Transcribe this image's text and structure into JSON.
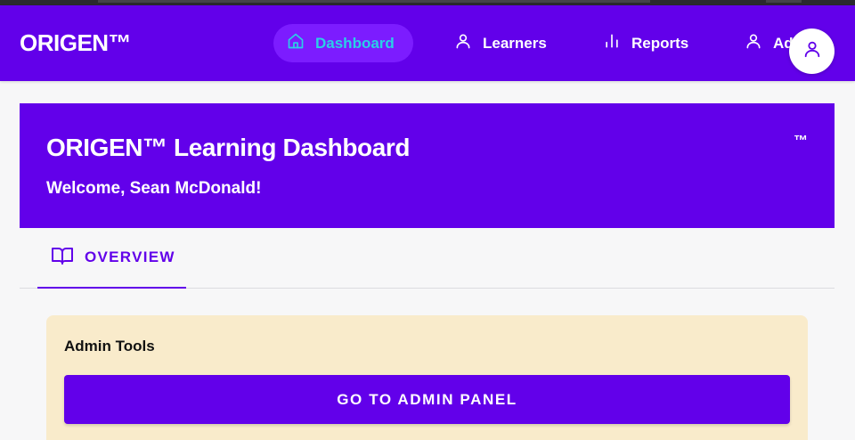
{
  "navbar": {
    "brand": "ORIGEN™",
    "items": [
      {
        "label": "Dashboard",
        "icon": "home-icon",
        "active": true
      },
      {
        "label": "Learners",
        "icon": "person-icon"
      },
      {
        "label": "Reports",
        "icon": "bar-chart-icon"
      },
      {
        "label": "Admin",
        "icon": "person-icon"
      }
    ],
    "avatar_icon": "user-icon"
  },
  "hero": {
    "title": "ORIGEN™ Learning Dashboard",
    "subtitle": "Welcome, Sean McDonald!",
    "tm": "™"
  },
  "tabs": [
    {
      "label": "OVERVIEW",
      "icon": "book-open-icon",
      "active": true
    }
  ],
  "admin_tools": {
    "title": "Admin Tools",
    "button_label": "GO TO ADMIN PANEL"
  },
  "colors": {
    "primary": "#6200ea",
    "active_nav_text": "#2ad0e6",
    "active_nav_bg": "#7c1cff",
    "card_bg": "#f9ebcb",
    "page_bg": "#f7f7f8"
  }
}
